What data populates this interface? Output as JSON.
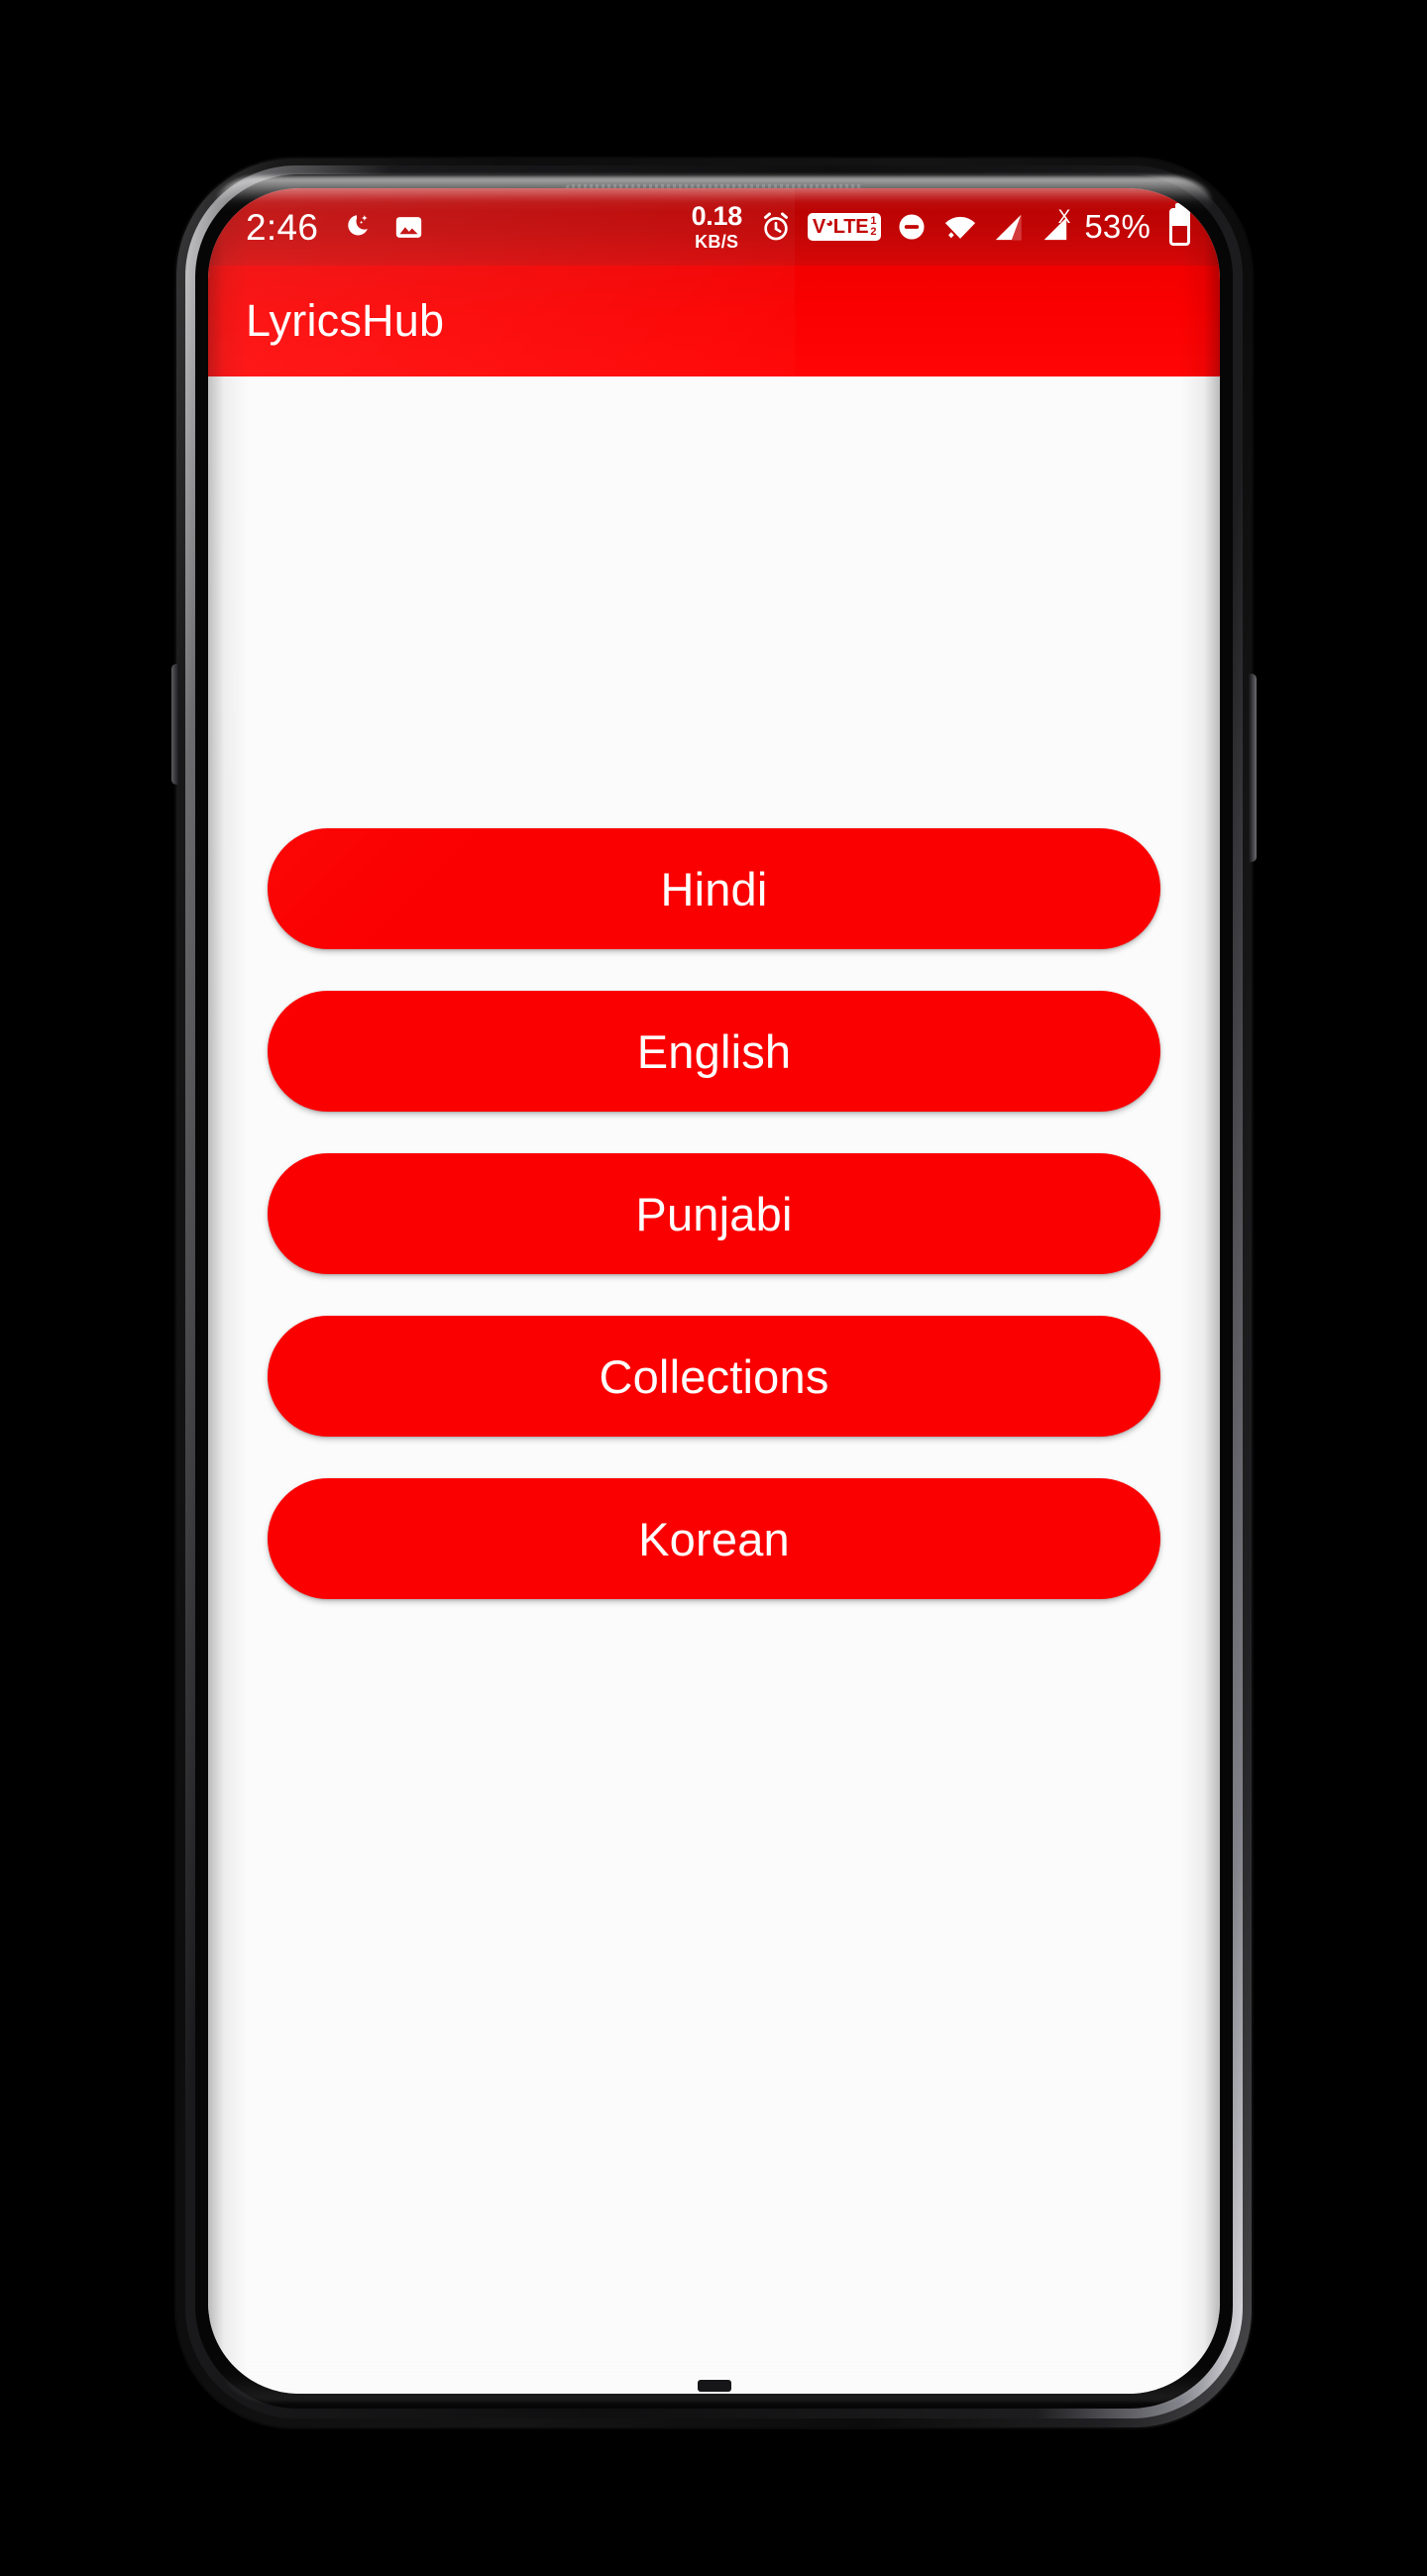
{
  "device": {
    "name": "android-phone-mockup"
  },
  "status_bar": {
    "time": "2:46",
    "dnd_icon": "moon-stars-icon",
    "screenshot_icon": "image-icon",
    "net_speed_value": "0.18",
    "net_speed_unit": "KB/S",
    "alarm_icon": "alarm-clock-icon",
    "volte_label": "V LTE",
    "volte_text_pre": "V",
    "volte_text_post": "LTE",
    "volte_sim_numerator": "1",
    "volte_sim_denominator": "2",
    "mute_icon": "do-not-disturb-icon",
    "wifi_icon": "wifi-icon",
    "signal_icon": "cellular-signal-icon",
    "signal_off_icon": "cellular-no-service-icon",
    "signal_off_mark": "X",
    "battery_percent": "53%",
    "battery_icon": "battery-icon",
    "background_color": "#c20505",
    "foreground_color": "#ffffff"
  },
  "app_bar": {
    "title": "LyricsHub",
    "background_color": "#fb0000",
    "title_color": "#ffffff"
  },
  "content": {
    "background_color": "#fbfbfb",
    "buttons": [
      {
        "label": "Hindi",
        "name": "hindi"
      },
      {
        "label": "English",
        "name": "english"
      },
      {
        "label": "Punjabi",
        "name": "punjabi"
      },
      {
        "label": "Collections",
        "name": "collections"
      },
      {
        "label": "Korean",
        "name": "korean"
      }
    ],
    "button_color": "#fb0000",
    "button_text_color": "#ffffff"
  }
}
